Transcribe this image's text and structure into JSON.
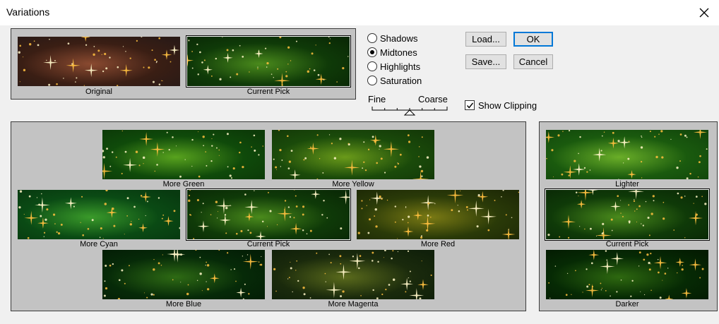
{
  "window": {
    "title": "Variations"
  },
  "top": {
    "original_label": "Original",
    "current_label": "Current Pick"
  },
  "tones": [
    {
      "label": "Shadows",
      "selected": false
    },
    {
      "label": "Midtones",
      "selected": true
    },
    {
      "label": "Highlights",
      "selected": false
    },
    {
      "label": "Saturation",
      "selected": false
    }
  ],
  "buttons": {
    "load": "Load...",
    "ok": "OK",
    "save": "Save...",
    "cancel": "Cancel"
  },
  "slider": {
    "fine_label": "Fine",
    "coarse_label": "Coarse",
    "level": 0.5
  },
  "show_clipping": {
    "label": "Show Clipping",
    "checked": true
  },
  "color_grid": {
    "more_green": "More Green",
    "more_yellow": "More Yellow",
    "more_cyan": "More Cyan",
    "current_pick": "Current Pick",
    "more_red": "More Red",
    "more_blue": "More Blue",
    "more_magenta": "More Magenta"
  },
  "brightness": {
    "lighter": "Lighter",
    "current_pick": "Current Pick",
    "darker": "Darker"
  }
}
